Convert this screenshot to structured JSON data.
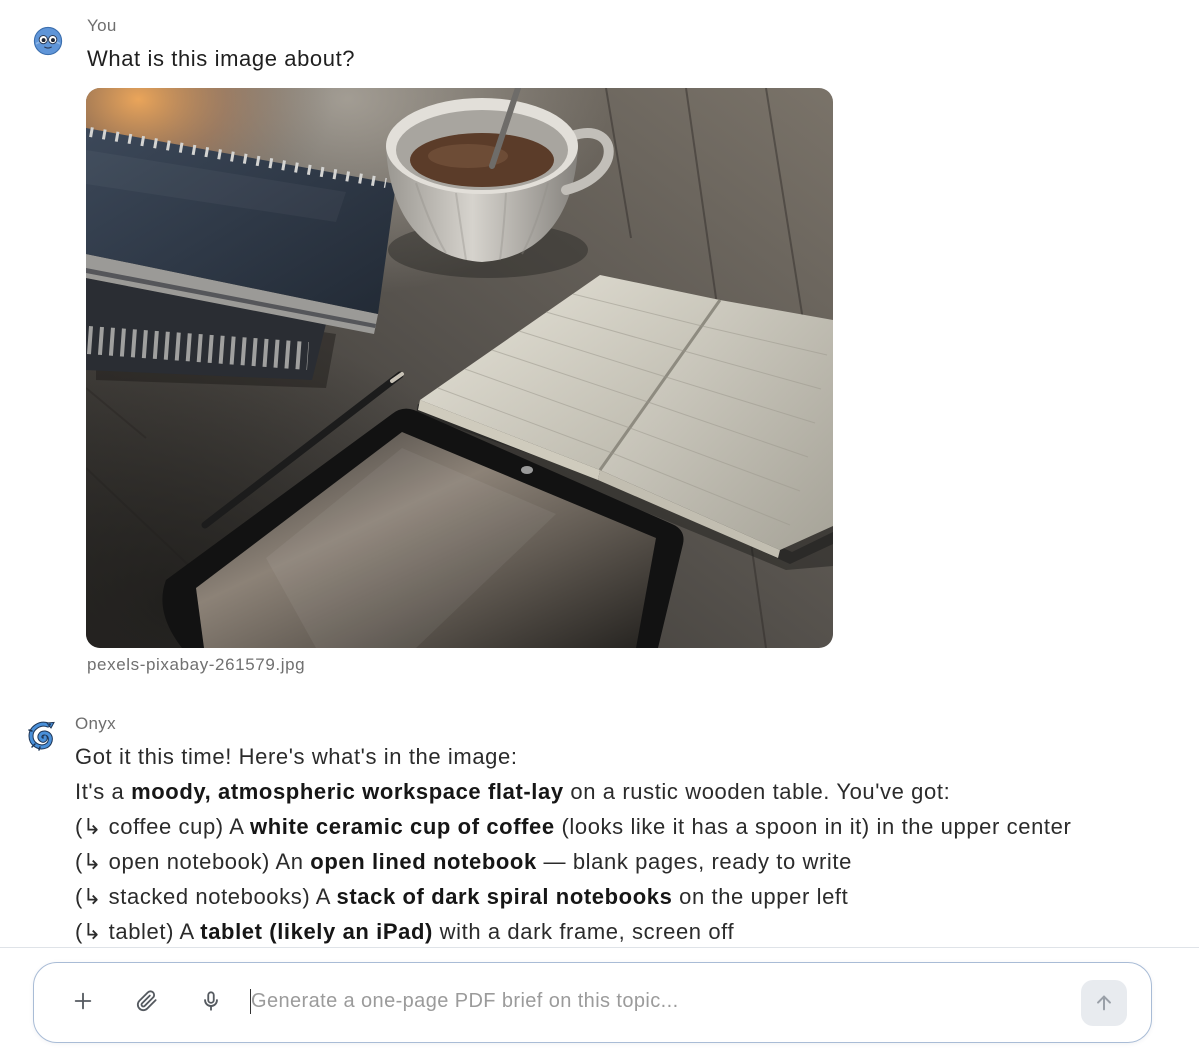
{
  "theme": {
    "text_color": "#2b2b2b",
    "muted_color": "#6e6e6e",
    "strong_color": "#161616",
    "composer_border_color": "#a9bcd6",
    "send_button_color": "#e8ebef"
  },
  "conversation": {
    "user_message": {
      "author": "You",
      "avatar_icon": "user-avatar-icon",
      "text": "What is this image about?",
      "attachment": {
        "filename": "pexels-pixabay-261579.jpg"
      }
    },
    "assistant_message": {
      "author": "Onyx",
      "avatar_icon": "onyx-logo-icon",
      "intro": "Got it this time! Here's what's in the image:",
      "lines": [
        {
          "prefix": "It's a ",
          "bold": "moody, atmospheric workspace flat-lay",
          "suffix": " on a rustic wooden table. You've got:"
        },
        {
          "prefix": "(↳ coffee cup) A ",
          "bold": "white ceramic cup of coffee",
          "suffix": " (looks like it has a spoon in it) in the upper center"
        },
        {
          "prefix": "(↳ open notebook) An ",
          "bold": "open lined notebook",
          "suffix": " — blank pages, ready to write"
        },
        {
          "prefix": "(↳ stacked notebooks) A ",
          "bold": "stack of dark spiral notebooks",
          "suffix": " on the upper left"
        },
        {
          "prefix": "(↳ tablet) A ",
          "bold": "tablet (likely an iPad)",
          "suffix": " with a dark frame, screen off"
        }
      ]
    }
  },
  "composer": {
    "placeholder": "Generate a one-page PDF brief on this topic...",
    "actions": [
      {
        "icon": "plus-icon"
      },
      {
        "icon": "paperclip-icon"
      },
      {
        "icon": "microphone-icon"
      }
    ],
    "send_icon": "arrow-up-icon"
  }
}
